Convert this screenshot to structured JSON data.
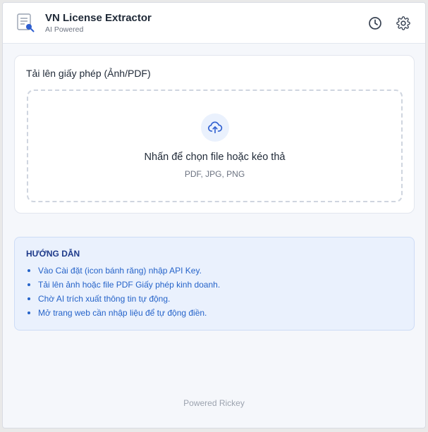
{
  "header": {
    "title": "VN License Extractor",
    "subtitle": "AI Powered",
    "logo_icon": "document-search-icon",
    "history_icon": "clock-icon",
    "settings_icon": "gear-icon"
  },
  "upload": {
    "title": "Tải lên giấy phép (Ảnh/PDF)",
    "dropzone_label": "Nhấn để chọn file hoặc kéo thả",
    "formats": "PDF, JPG, PNG",
    "icon": "cloud-upload-icon"
  },
  "guide": {
    "title": "HƯỚNG DẪN",
    "items": [
      "Vào Cài đặt (icon bánh răng) nhập API Key.",
      "Tải lên ảnh hoặc file PDF Giấy phép kinh doanh.",
      "Chờ AI trích xuất thông tin tự động.",
      "Mở trang web cần nhập liệu để tự động điền."
    ]
  },
  "footer": {
    "text": "Powered Rickey"
  },
  "colors": {
    "accent": "#2563c9",
    "guide_bg": "#eaf1fd",
    "guide_title": "#1e3a8a",
    "panel_bg": "#f5f7fb"
  }
}
